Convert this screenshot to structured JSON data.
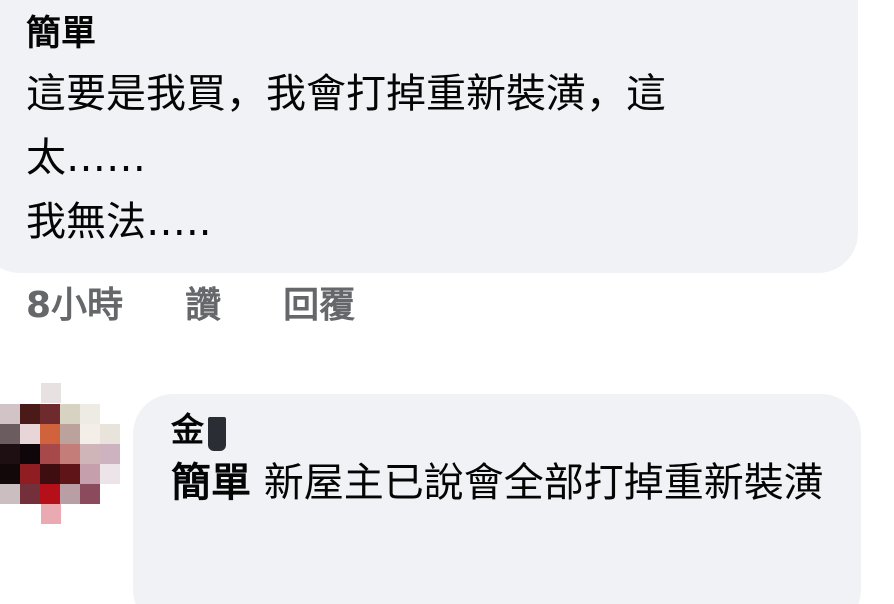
{
  "comment": {
    "author": "簡單",
    "lines": [
      "這要是我買，我會打掉重新裝潢，這",
      "太……",
      "我無法….."
    ]
  },
  "actions": {
    "time": "8小時",
    "like": "讚",
    "reply": "回覆"
  },
  "reply": {
    "author_visible": "金",
    "mention": "簡單",
    "text": "新屋主已說會全部打掉重新裝潢"
  },
  "colors": {
    "bubble_bg": "#f0f2f5",
    "text": "#050505",
    "meta": "#65676b"
  },
  "icons": {
    "avatar": "pixelated-avatar-icon"
  }
}
